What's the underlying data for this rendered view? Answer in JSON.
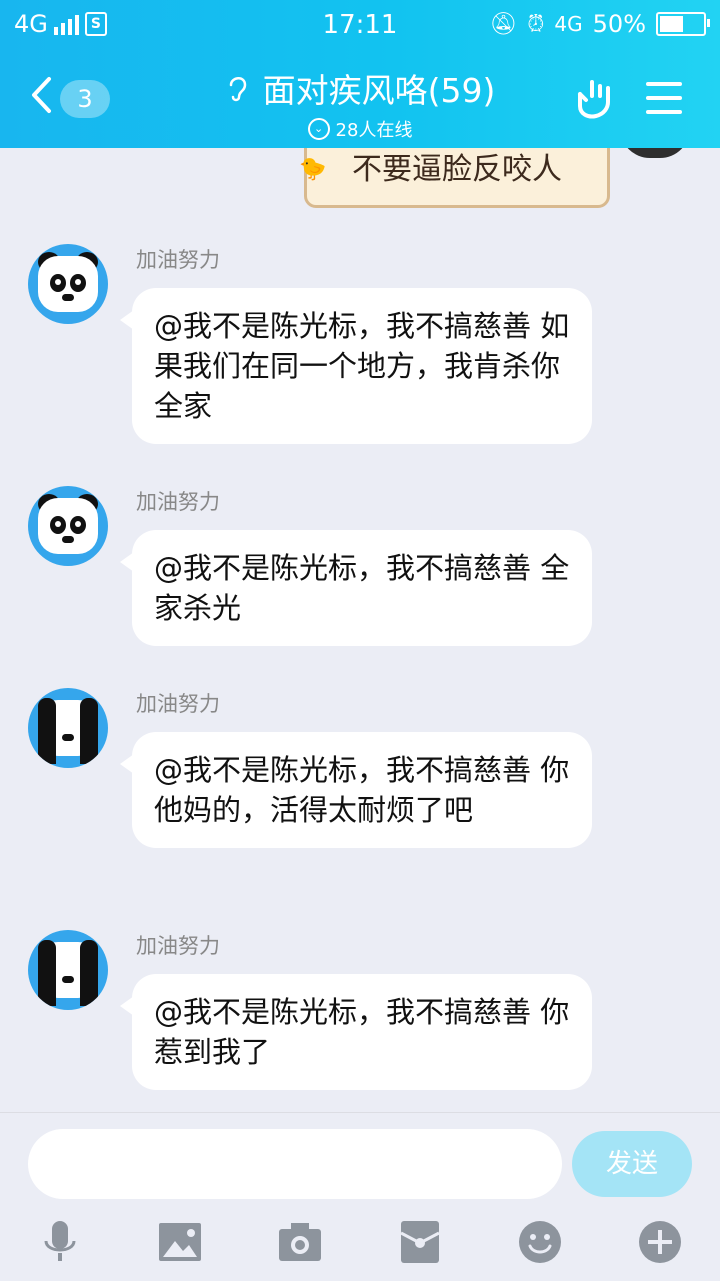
{
  "status_bar": {
    "network_left": "4G",
    "time": "17:11",
    "network_right": "4G",
    "battery_percent": "50%",
    "battery_level": 0.5
  },
  "header": {
    "back_count": "3",
    "title": "面对疾风咯(59)",
    "online": "28人在线"
  },
  "sticker_text": "不要逼脸反咬人",
  "messages": [
    {
      "sender": "加油努力",
      "text": "@我不是陈光标，我不搞慈善 如果我们在同一个地方，我肯杀你全家"
    },
    {
      "sender": "加油努力",
      "text": "@我不是陈光标，我不搞慈善 全家杀光"
    },
    {
      "sender": "加油努力",
      "text": "@我不是陈光标，我不搞慈善 你他妈的，活得太耐烦了吧"
    },
    {
      "sender": "加油努力",
      "text": "@我不是陈光标，我不搞慈善 你惹到我了"
    }
  ],
  "input": {
    "value": "",
    "placeholder": ""
  },
  "send_label": "发送",
  "toolbar_icons": [
    "microphone-icon",
    "image-icon",
    "camera-icon",
    "red-packet-icon",
    "emoji-icon",
    "plus-icon"
  ],
  "colors": {
    "header": "#12c3f0",
    "background": "#ebedf5",
    "send_button": "#a4e4f6",
    "avatar_bg": "#35a6ec"
  }
}
